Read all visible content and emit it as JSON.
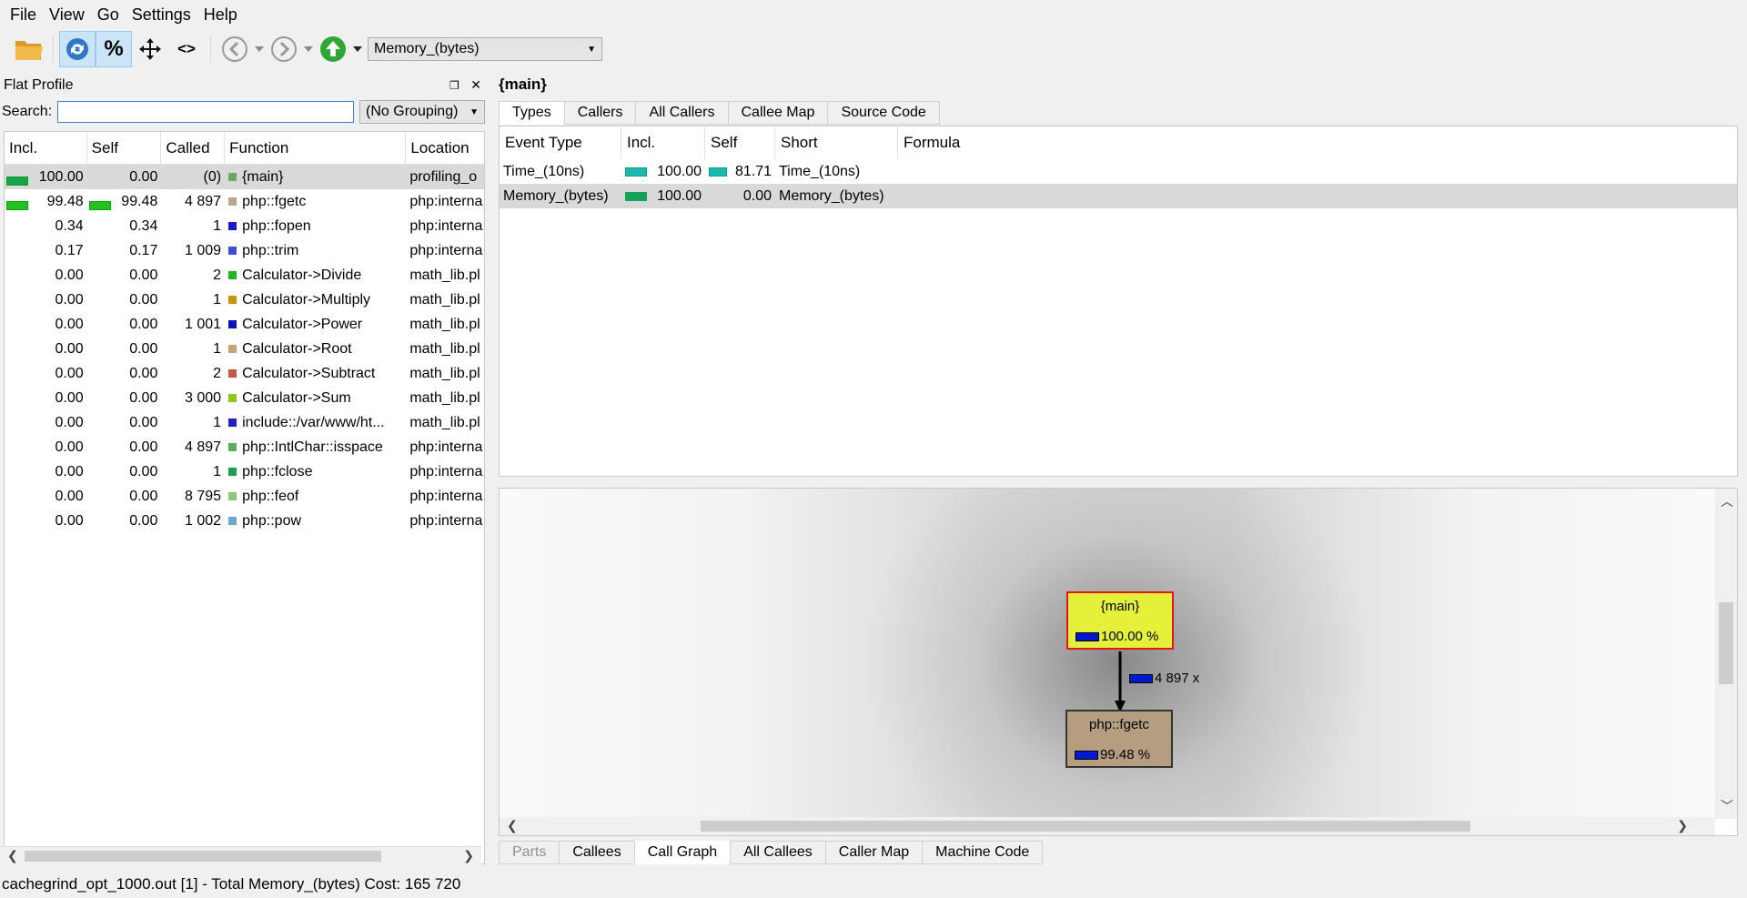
{
  "menu": [
    "File",
    "View",
    "Go",
    "Settings",
    "Help"
  ],
  "toolbar": {
    "event_type_selected": "Memory_(bytes)"
  },
  "flat_profile": {
    "title": "Flat Profile",
    "search_label": "Search:",
    "search_value": "",
    "grouping": "(No Grouping)",
    "columns": [
      "Incl.",
      "Self",
      "Called",
      "Function",
      "Location"
    ],
    "rows": [
      {
        "incl": "100.00",
        "self": "0.00",
        "called": "(0)",
        "function": "{main}",
        "location": "profiling_o",
        "color": "#6aaa5a",
        "incl_bar": 1.0,
        "self_bar": 0
      },
      {
        "incl": "99.48",
        "self": "99.48",
        "called": "4 897",
        "function": "php::fgetc",
        "location": "php:interna",
        "color": "#b8a88a",
        "incl_bar": 0.9948,
        "self_bar": 0.9948
      },
      {
        "incl": "0.34",
        "self": "0.34",
        "called": "1",
        "function": "php::fopen",
        "location": "php:interna",
        "color": "#1a1acc",
        "incl_bar": 0,
        "self_bar": 0
      },
      {
        "incl": "0.17",
        "self": "0.17",
        "called": "1 009",
        "function": "php::trim",
        "location": "php:interna",
        "color": "#3a4fd0",
        "incl_bar": 0,
        "self_bar": 0
      },
      {
        "incl": "0.00",
        "self": "0.00",
        "called": "2",
        "function": "Calculator->Divide",
        "location": "math_lib.pl",
        "color": "#22b422",
        "incl_bar": 0,
        "self_bar": 0
      },
      {
        "incl": "0.00",
        "self": "0.00",
        "called": "1",
        "function": "Calculator->Multiply",
        "location": "math_lib.pl",
        "color": "#c8960a",
        "incl_bar": 0,
        "self_bar": 0
      },
      {
        "incl": "0.00",
        "self": "0.00",
        "called": "1 001",
        "function": "Calculator->Power",
        "location": "math_lib.pl",
        "color": "#1010b8",
        "incl_bar": 0,
        "self_bar": 0
      },
      {
        "incl": "0.00",
        "self": "0.00",
        "called": "1",
        "function": "Calculator->Root",
        "location": "math_lib.pl",
        "color": "#c4a478",
        "incl_bar": 0,
        "self_bar": 0
      },
      {
        "incl": "0.00",
        "self": "0.00",
        "called": "2",
        "function": "Calculator->Subtract",
        "location": "math_lib.pl",
        "color": "#c0584a",
        "incl_bar": 0,
        "self_bar": 0
      },
      {
        "incl": "0.00",
        "self": "0.00",
        "called": "3 000",
        "function": "Calculator->Sum",
        "location": "math_lib.pl",
        "color": "#8ac81a",
        "incl_bar": 0,
        "self_bar": 0
      },
      {
        "incl": "0.00",
        "self": "0.00",
        "called": "1",
        "function": "include::/var/www/ht...",
        "location": "math_lib.pl",
        "color": "#2020c0",
        "incl_bar": 0,
        "self_bar": 0
      },
      {
        "incl": "0.00",
        "self": "0.00",
        "called": "4 897",
        "function": "php::IntlChar::isspace",
        "location": "php:interna",
        "color": "#5ab05a",
        "incl_bar": 0,
        "self_bar": 0
      },
      {
        "incl": "0.00",
        "self": "0.00",
        "called": "1",
        "function": "php::fclose",
        "location": "php:interna",
        "color": "#1aa04a",
        "incl_bar": 0,
        "self_bar": 0
      },
      {
        "incl": "0.00",
        "self": "0.00",
        "called": "8 795",
        "function": "php::feof",
        "location": "php:interna",
        "color": "#8ac87a",
        "incl_bar": 0,
        "self_bar": 0
      },
      {
        "incl": "0.00",
        "self": "0.00",
        "called": "1 002",
        "function": "php::pow",
        "location": "php:interna",
        "color": "#6aa8d0",
        "incl_bar": 0,
        "self_bar": 0
      }
    ]
  },
  "status": "cachegrind_opt_1000.out [1] - Total Memory_(bytes) Cost: 165 720",
  "detail": {
    "title": "{main}",
    "top_tabs": [
      "Types",
      "Callers",
      "All Callers",
      "Callee Map",
      "Source Code"
    ],
    "top_active": "Types",
    "types_columns": [
      "Event Type",
      "Incl.",
      "Self",
      "Short",
      "Formula"
    ],
    "types_rows": [
      {
        "event": "Time_(10ns)",
        "incl": "100.00",
        "self": "81.71",
        "short": "Time_(10ns)",
        "formula": "",
        "incl_bar": 1.0,
        "self_bar": 0.8171,
        "bar_color": "#1ab8b0"
      },
      {
        "event": "Memory_(bytes)",
        "incl": "100.00",
        "self": "0.00",
        "short": "Memory_(bytes)",
        "formula": "",
        "incl_bar": 1.0,
        "self_bar": 0,
        "bar_color": "#1aa050"
      }
    ],
    "bottom_tabs": [
      "Parts",
      "Callees",
      "Call Graph",
      "All Callees",
      "Caller Map",
      "Machine Code"
    ],
    "bottom_active": "Call Graph",
    "graph": {
      "caller": {
        "name": "{main}",
        "pct": "100.00 %"
      },
      "callee": {
        "name": "php::fgetc",
        "pct": "99.48 %"
      },
      "edge_label": "4 897 x"
    }
  }
}
